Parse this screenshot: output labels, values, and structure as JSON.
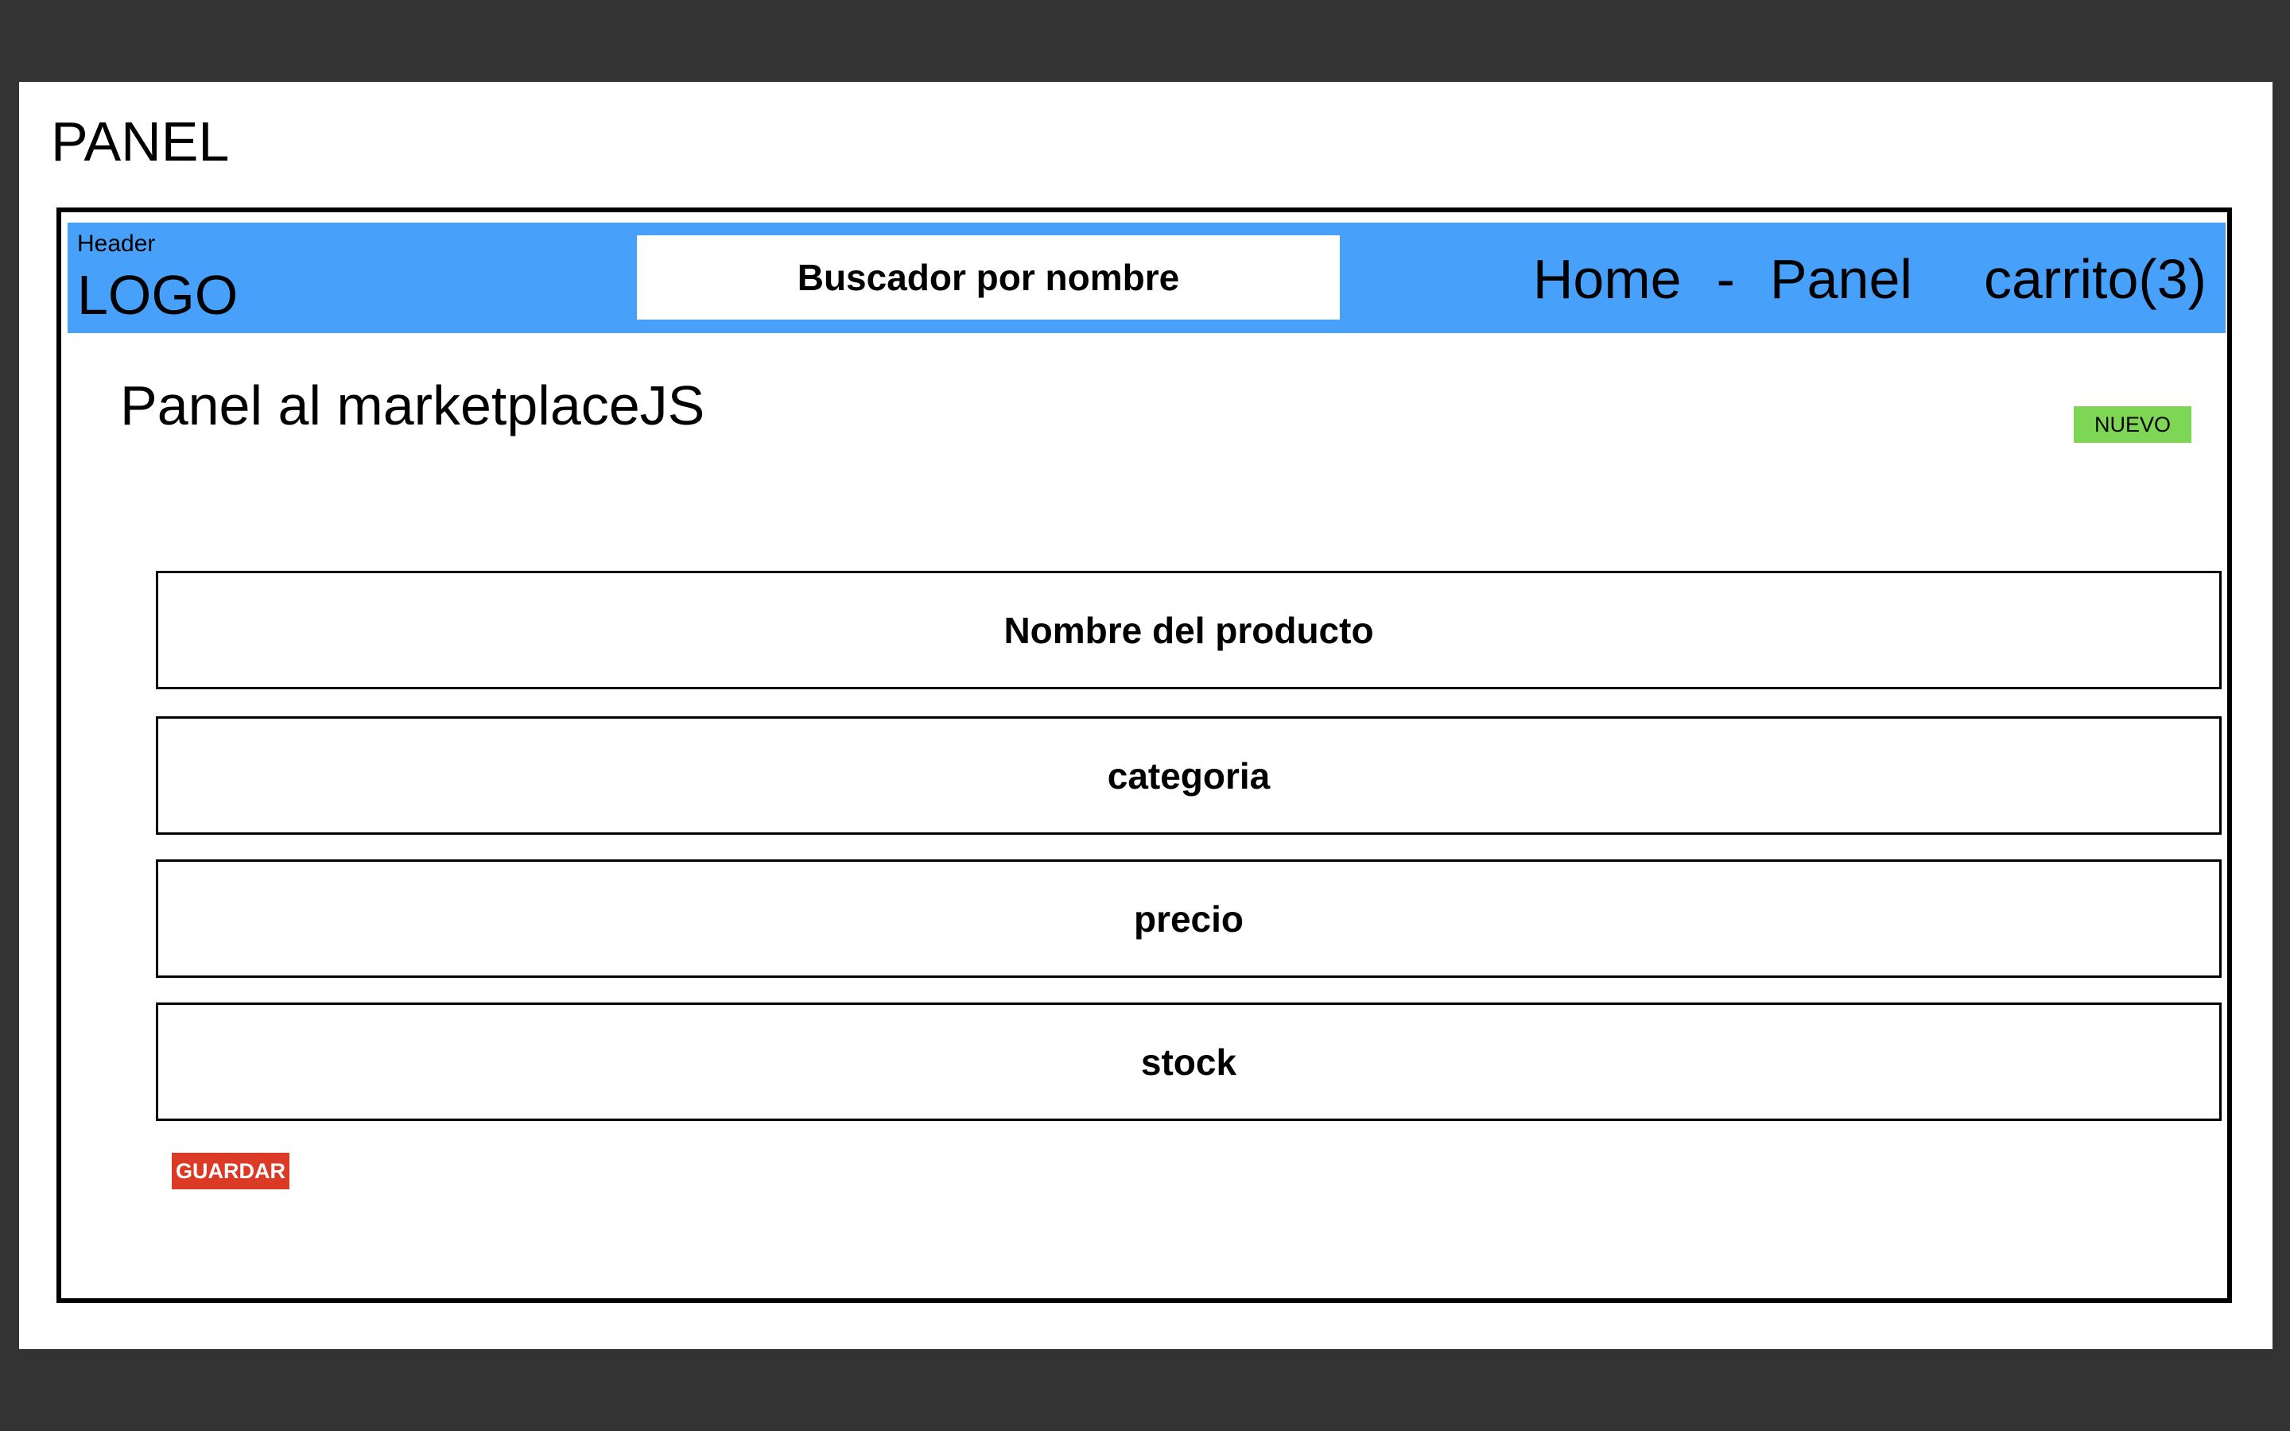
{
  "board": {
    "title": "PANEL"
  },
  "header": {
    "caption": "Header",
    "logo": "LOGO",
    "search_placeholder": "Buscador por nombre",
    "nav": {
      "home": "Home",
      "separator": "-",
      "panel": "Panel",
      "cart": "carrito(3)"
    },
    "background_color": "#47a1fa"
  },
  "main": {
    "title": "Panel al marketplaceJS",
    "new_button": "NUEVO",
    "new_button_color": "#7dd654",
    "form": {
      "fields": [
        {
          "placeholder": "Nombre del producto"
        },
        {
          "placeholder": "categoria"
        },
        {
          "placeholder": "precio"
        },
        {
          "placeholder": "stock"
        }
      ],
      "save_button": "GUARDAR",
      "save_button_color": "#db3b26"
    }
  }
}
